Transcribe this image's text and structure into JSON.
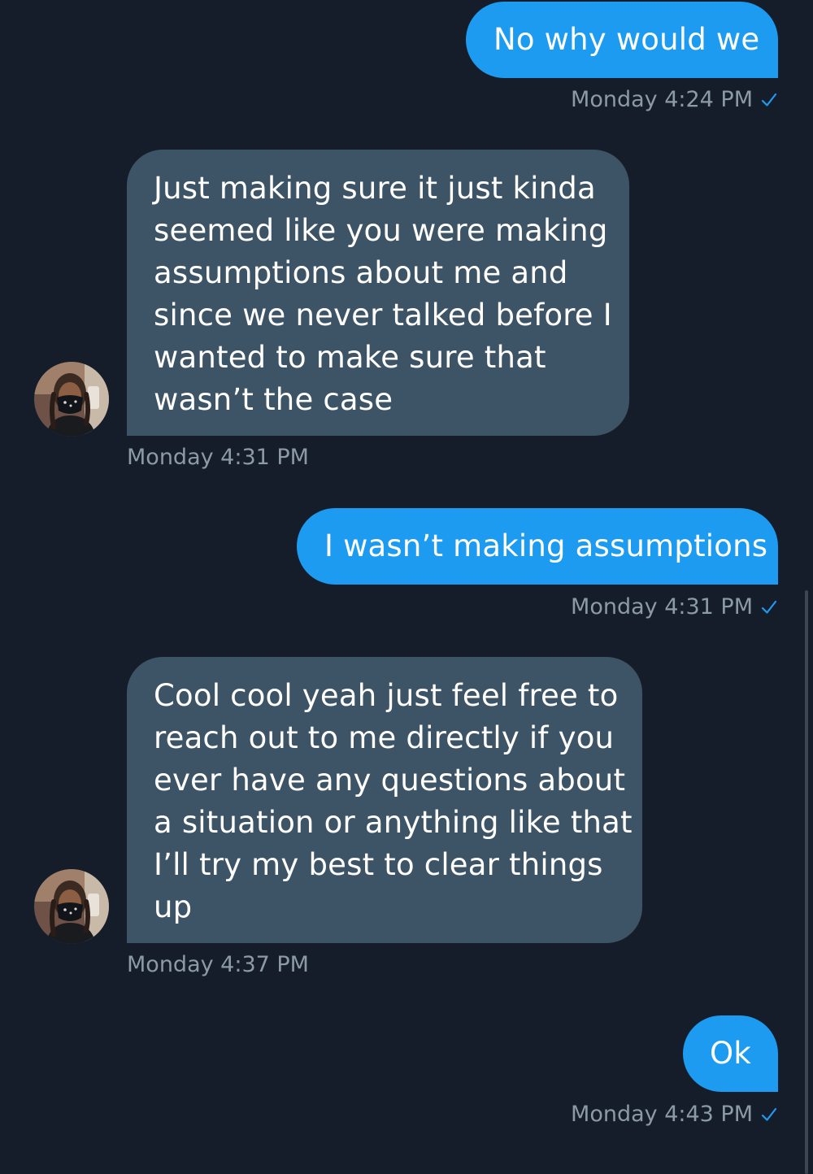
{
  "conversation": {
    "messages": [
      {
        "direction": "sent",
        "text": "No why would we",
        "timestamp": "Monday 4:24 PM",
        "status": "check-icon"
      },
      {
        "direction": "received",
        "lines": [
          "Just making sure it just kinda",
          "seemed like you were making",
          "assumptions about me and",
          "since we never talked before I",
          "wanted to make sure that",
          "wasn’t the case"
        ],
        "timestamp": "Monday 4:31 PM",
        "avatar": "avatar"
      },
      {
        "direction": "sent",
        "text": "I wasn’t making assumptions",
        "timestamp": "Monday 4:31 PM",
        "status": "check-icon"
      },
      {
        "direction": "received",
        "lines": [
          "Cool cool yeah just feel free to",
          "reach out to me directly if you",
          "ever have any questions about",
          "a situation or anything like that",
          "I’ll try my best to clear things",
          "up"
        ],
        "timestamp": "Monday 4:37 PM",
        "avatar": "avatar"
      },
      {
        "direction": "sent",
        "text": "Ok",
        "timestamp": "Monday 4:43 PM",
        "status": "check-icon"
      }
    ]
  },
  "colors": {
    "background": "#151d2a",
    "sent_bubble": "#1d9bf0",
    "received_bubble": "#3d5466",
    "timestamp": "#8c9aa7",
    "check": "#1d9bf0"
  }
}
